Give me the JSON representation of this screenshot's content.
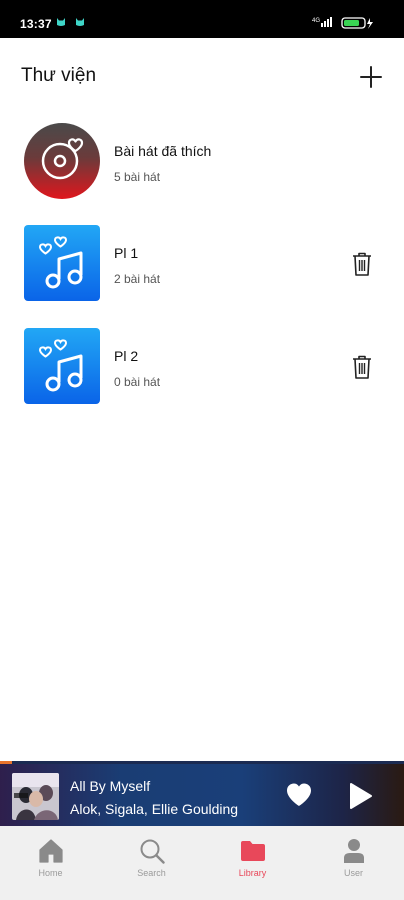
{
  "status_bar": {
    "time": "13:37",
    "network": "4G"
  },
  "header": {
    "title": "Thư viện",
    "add_icon": "plus-icon"
  },
  "library": {
    "items": [
      {
        "title": "Bài hát đã thích",
        "subtitle": "5 bài hát",
        "art": "liked-songs-disc"
      },
      {
        "title": "Pl 1",
        "subtitle": "2 bài hát",
        "art": "playlist-music-note",
        "action_icon": "trash-icon"
      },
      {
        "title": "Pl 2",
        "subtitle": "0 bài hát",
        "art": "playlist-music-note",
        "action_icon": "trash-icon"
      }
    ]
  },
  "mini_player": {
    "title": "All By Myself",
    "artist": "Alok, Sigala, Ellie Goulding",
    "like_icon": "heart-icon",
    "play_icon": "play-icon"
  },
  "bottom_nav": {
    "items": [
      {
        "label": "Home",
        "icon": "home-icon"
      },
      {
        "label": "Search",
        "icon": "search-icon"
      },
      {
        "label": "Library",
        "icon": "folder-icon",
        "active": true
      },
      {
        "label": "User",
        "icon": "user-icon"
      }
    ]
  },
  "colors": {
    "accent": "#e8485a",
    "playlist_art": "#1a8cf2",
    "liked_art": "#d82c2c",
    "nav_background": "#f0f0f0"
  }
}
